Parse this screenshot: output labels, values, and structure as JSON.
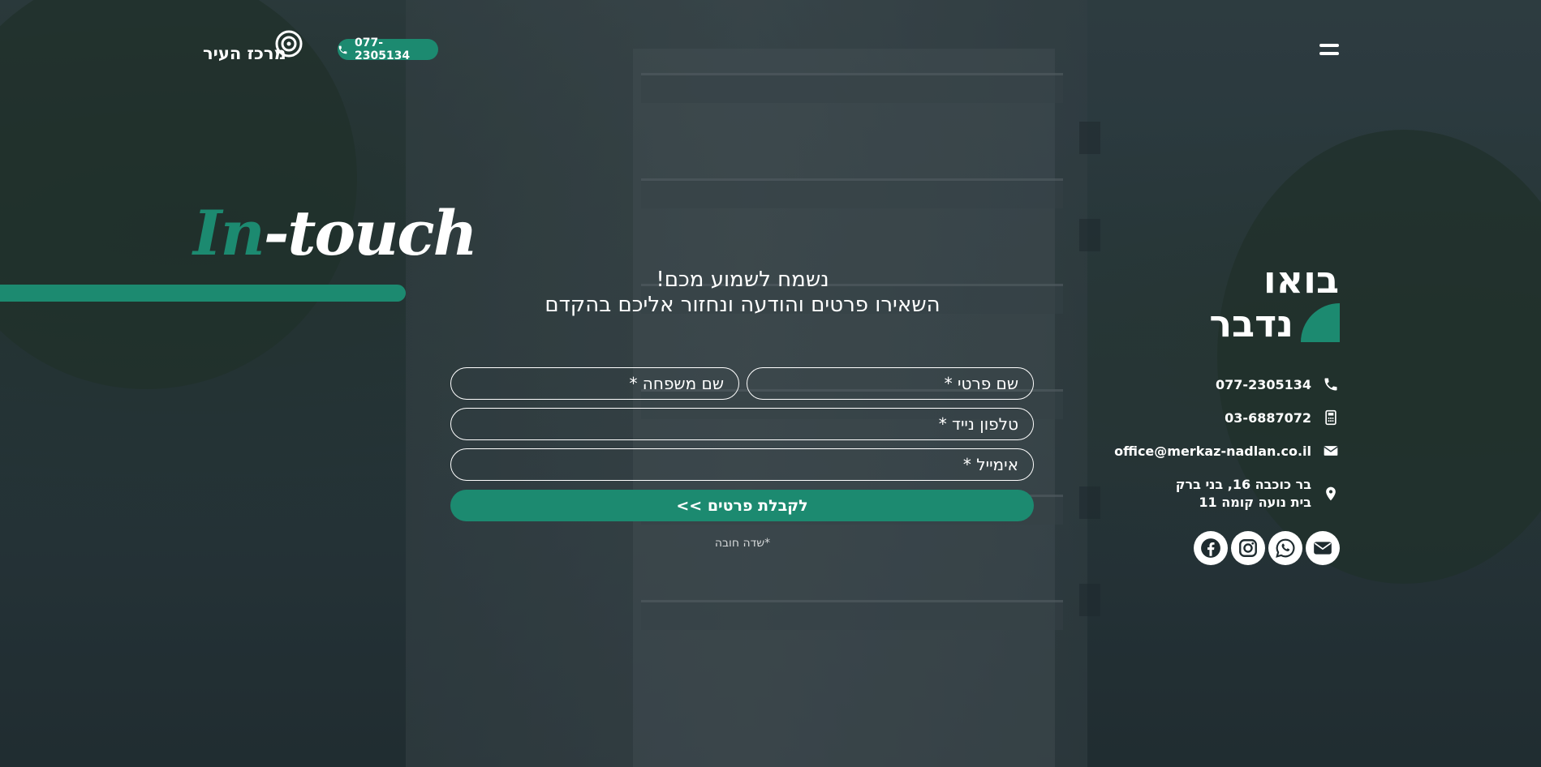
{
  "header": {
    "logo_text": "מרכז העיר",
    "phone": "077-2305134"
  },
  "hero": {
    "brand_in": "In",
    "brand_touch": "-touch"
  },
  "form": {
    "title_line1": "נשמח לשמוע מכם!",
    "title_line2": "השאירו פרטים והודעה ונחזור אליכם בהקדם",
    "first_name_placeholder": "שם פרטי *",
    "last_name_placeholder": "שם משפחה *",
    "mobile_placeholder": "טלפון נייד *",
    "email_placeholder": "אימייל *",
    "submit_label": "לקבלת פרטים >>",
    "required_note": "*שדה חובה"
  },
  "contact": {
    "heading_line1": "בואו",
    "heading_line2": "נדבר",
    "phone": "077-2305134",
    "fax": "03-6887072",
    "email": "office@merkaz-nadlan.co.il",
    "address_line1": "בר כוכבה 16, בני ברק",
    "address_line2": "בית נועה קומה 11"
  },
  "socials": {
    "icons": [
      "facebook-icon",
      "instagram-icon",
      "whatsapp-icon",
      "mail-icon"
    ]
  },
  "colors": {
    "accent": "#1c8a70",
    "text": "#ffffff"
  }
}
